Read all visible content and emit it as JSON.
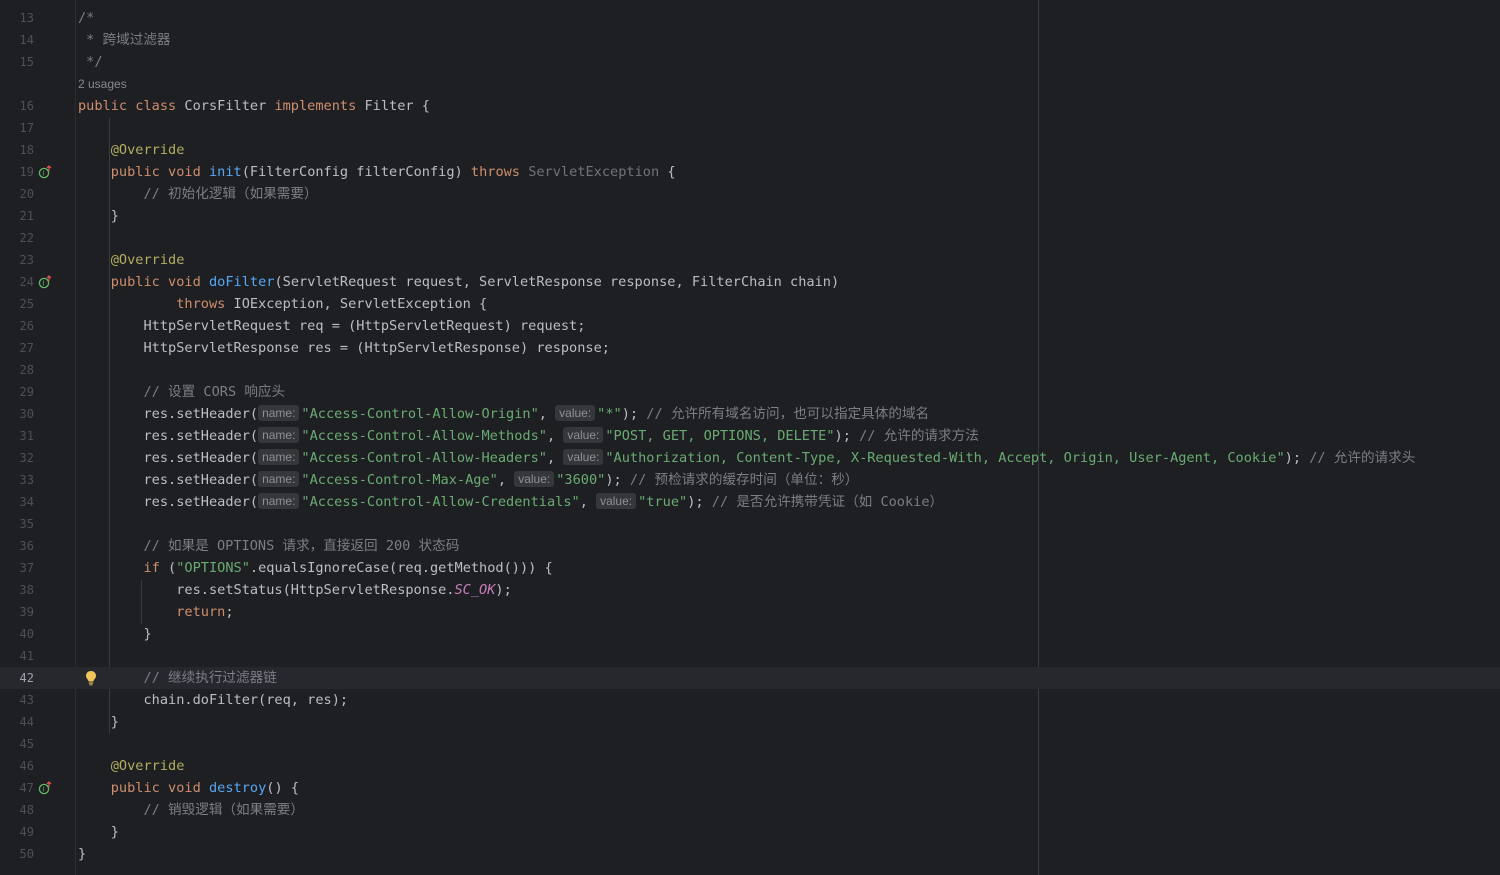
{
  "editor": {
    "usages_hint": "2 usages",
    "lines": {
      "l13": {
        "num": "13",
        "c": "/*"
      },
      "l14": {
        "num": "14",
        "c": " * 跨域过滤器"
      },
      "l15": {
        "num": "15",
        "c": " */"
      },
      "l16": {
        "num": "16",
        "kw1": "public class",
        "name": "CorsFilter",
        "kw2": "implements",
        "rest": "Filter {"
      },
      "l17": {
        "num": "17"
      },
      "l18": {
        "num": "18",
        "ann": "@Override"
      },
      "l19": {
        "num": "19",
        "kw": "public void",
        "fn": "init",
        "args": "(FilterConfig filterConfig)",
        "throws": "throws",
        "exc": "ServletException",
        "tail": "{"
      },
      "l20": {
        "num": "20",
        "c": "// 初始化逻辑（如果需要）"
      },
      "l21": {
        "num": "21",
        "t": "}"
      },
      "l22": {
        "num": "22"
      },
      "l23": {
        "num": "23",
        "ann": "@Override"
      },
      "l24": {
        "num": "24",
        "kw": "public void",
        "fn": "doFilter",
        "args": "(ServletRequest request, ServletResponse response, FilterChain chain)"
      },
      "l25": {
        "num": "25",
        "throws": "throws",
        "rest": "IOException, ServletException {"
      },
      "l26": {
        "num": "26",
        "t": "HttpServletRequest req = (HttpServletRequest) request;"
      },
      "l27": {
        "num": "27",
        "t": "HttpServletResponse res = (HttpServletResponse) response;"
      },
      "l28": {
        "num": "28"
      },
      "l29": {
        "num": "29",
        "c": "// 设置 CORS 响应头"
      },
      "l30": {
        "num": "30",
        "call": "res.setHeader(",
        "name_hint": "name:",
        "key": "\"Access-Control-Allow-Origin\"",
        "sep": ",",
        "value_hint": "value:",
        "val": "\"*\"",
        "end": ");",
        "c": "// 允许所有域名访问，也可以指定具体的域名"
      },
      "l31": {
        "num": "31",
        "call": "res.setHeader(",
        "name_hint": "name:",
        "key": "\"Access-Control-Allow-Methods\"",
        "sep": ",",
        "value_hint": "value:",
        "val": "\"POST, GET, OPTIONS, DELETE\"",
        "end": ");",
        "c": "// 允许的请求方法"
      },
      "l32": {
        "num": "32",
        "call": "res.setHeader(",
        "name_hint": "name:",
        "key": "\"Access-Control-Allow-Headers\"",
        "sep": ",",
        "value_hint": "value:",
        "val": "\"Authorization, Content-Type, X-Requested-With, Accept, Origin, User-Agent, Cookie\"",
        "end": ");",
        "c": "// 允许的请求头"
      },
      "l33": {
        "num": "33",
        "call": "res.setHeader(",
        "name_hint": "name:",
        "key": "\"Access-Control-Max-Age\"",
        "sep": ",",
        "value_hint": "value:",
        "val": "\"3600\"",
        "end": ");",
        "c": "// 预检请求的缓存时间（单位：秒）"
      },
      "l34": {
        "num": "34",
        "call": "res.setHeader(",
        "name_hint": "name:",
        "key": "\"Access-Control-Allow-Credentials\"",
        "sep": ",",
        "value_hint": "value:",
        "val": "\"true\"",
        "end": ");",
        "c": "// 是否允许携带凭证（如 Cookie）"
      },
      "l35": {
        "num": "35"
      },
      "l36": {
        "num": "36",
        "c": "// 如果是 OPTIONS 请求，直接返回 200 状态码"
      },
      "l37": {
        "num": "37",
        "kw": "if",
        "p1": "(",
        "str": "\"OPTIONS\"",
        "rest": ".equalsIgnoreCase(req.getMethod())) {"
      },
      "l38": {
        "num": "38",
        "pre": "res.setStatus(HttpServletResponse.",
        "cst": "SC_OK",
        "post": ");"
      },
      "l39": {
        "num": "39",
        "kw": "return",
        "post": ";"
      },
      "l40": {
        "num": "40",
        "t": "}"
      },
      "l41": {
        "num": "41"
      },
      "l42": {
        "num": "42",
        "c": "// 继续执行过滤器链"
      },
      "l43": {
        "num": "43",
        "t": "chain.doFilter(req, res);"
      },
      "l44": {
        "num": "44",
        "t": "}"
      },
      "l45": {
        "num": "45"
      },
      "l46": {
        "num": "46",
        "ann": "@Override"
      },
      "l47": {
        "num": "47",
        "kw": "public void",
        "fn": "destroy",
        "rest": "() {"
      },
      "l48": {
        "num": "48",
        "c": "// 销毁逻辑（如果需要）"
      },
      "l49": {
        "num": "49",
        "t": "}"
      },
      "l50": {
        "num": "50",
        "t": "}"
      }
    }
  }
}
